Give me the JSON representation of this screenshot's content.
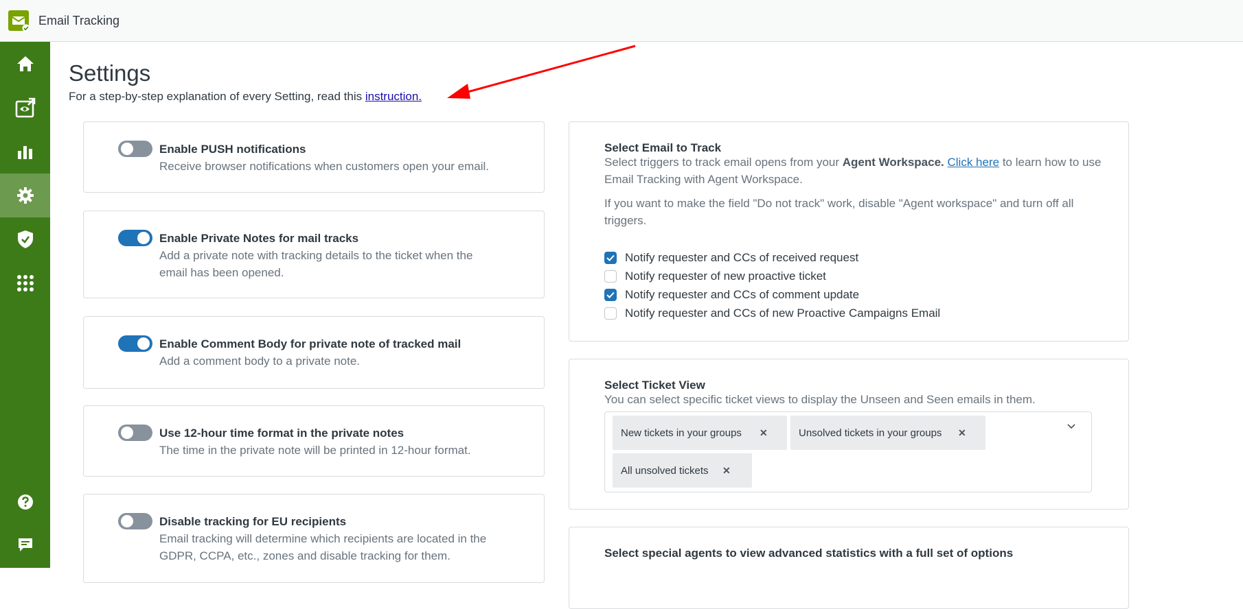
{
  "app": {
    "title": "Email Tracking"
  },
  "sidebar": {
    "items": [
      {
        "name": "home",
        "icon": "home-icon"
      },
      {
        "name": "tracked-emails",
        "icon": "eye-icon"
      },
      {
        "name": "statistics",
        "icon": "bar-chart-icon"
      },
      {
        "name": "settings",
        "icon": "gear-icon",
        "active": true
      },
      {
        "name": "security",
        "icon": "shield-icon"
      },
      {
        "name": "apps",
        "icon": "grid-icon"
      },
      {
        "name": "help",
        "icon": "question-icon"
      },
      {
        "name": "feedback",
        "icon": "chat-icon"
      }
    ],
    "accent": "#3d7b19",
    "active_bg": "#6c9a4f"
  },
  "page": {
    "title": "Settings",
    "subtitle_prefix": "For a step-by-step explanation of every Setting, read this ",
    "subtitle_link": "instruction."
  },
  "settings": [
    {
      "title": "Enable PUSH notifications",
      "desc": "Receive browser notifications when customers open your email.",
      "enabled": false
    },
    {
      "title": "Enable Private Notes for mail tracks",
      "desc": "Add a private note with tracking details to the ticket when the email has been opened.",
      "enabled": true
    },
    {
      "title": "Enable Comment Body for private note of tracked mail",
      "desc": "Add a comment body to a private note.",
      "enabled": true
    },
    {
      "title": "Use 12-hour time format in the private notes",
      "desc": "The time in the private note will be printed in 12-hour format.",
      "enabled": false
    },
    {
      "title": "Disable tracking for EU recipients",
      "desc": "Email tracking will determine which recipients are located in the GDPR, CCPA, etc., zones and disable tracking for them.",
      "enabled": false
    }
  ],
  "select_email": {
    "title": "Select Email to Track",
    "desc_prefix": "Select triggers to track email opens from your ",
    "desc_bold": "Agent Workspace.",
    "desc_link": "Click here",
    "desc_suffix": " to learn how to use Email Tracking with Agent Workspace.",
    "desc2": "If you want to make the field \"Do not track\" work, disable \"Agent workspace\" and turn off all triggers.",
    "triggers": [
      {
        "label": "Notify requester and CCs of received request",
        "checked": true
      },
      {
        "label": "Notify requester of new proactive ticket",
        "checked": false
      },
      {
        "label": "Notify requester and CCs of comment update",
        "checked": true
      },
      {
        "label": "Notify requester and CCs of new Proactive Campaigns Email",
        "checked": false
      }
    ]
  },
  "ticket_view": {
    "title": "Select Ticket View",
    "desc": "You can select specific ticket views to display the Unseen and Seen emails in them.",
    "chips": [
      "New tickets in your groups",
      "Unsolved tickets in your groups",
      "All unsolved tickets"
    ]
  },
  "special_agents": {
    "title": "Select special agents to view advanced statistics with a full set of options"
  }
}
